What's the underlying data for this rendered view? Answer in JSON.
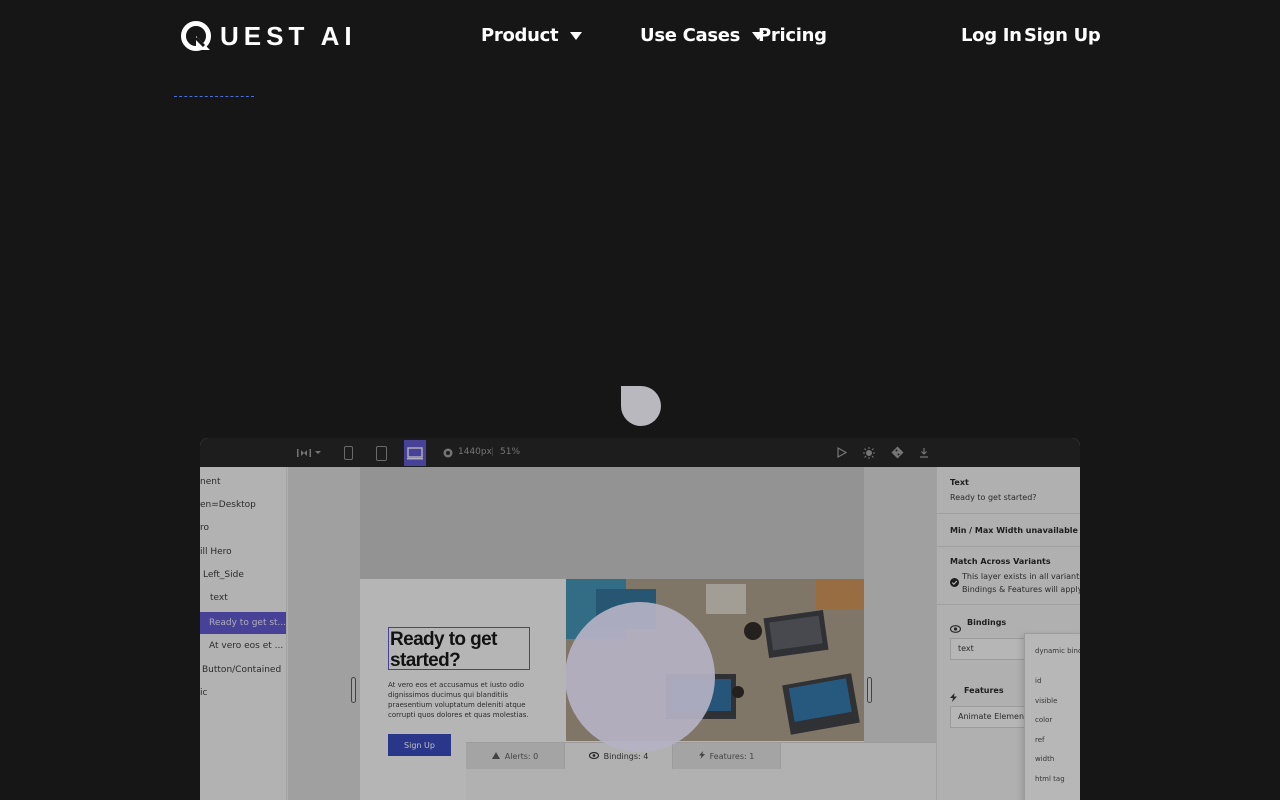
{
  "nav": {
    "logo_text": "UEST AI",
    "product": "Product",
    "use_cases": "Use Cases",
    "pricing": "Pricing",
    "login": "Log In",
    "signup": "Sign Up"
  },
  "editor": {
    "toolbar": {
      "width_label": "1440px",
      "zoom_label": "51%"
    },
    "layers": [
      "nent",
      "en=Desktop",
      "ro",
      "ill Hero",
      "Left_Side",
      "text",
      "Ready to get st...",
      "At vero eos et ...",
      "Button/Contained",
      "ic"
    ],
    "artboard": {
      "heading": "Ready to get started?",
      "paragraph": "At vero eos et accusamus et iusto odio dignissimos ducimus qui blanditiis praesentium voluptatum deleniti atque corrupti quos dolores et quas molestias.",
      "button": "Sign Up"
    },
    "bottom_tabs": [
      {
        "label": "Alerts: 0"
      },
      {
        "label": "Bindings: 4"
      },
      {
        "label": "Features: 1"
      }
    ],
    "props": {
      "text_label": "Text",
      "text_value": "Ready to get started?",
      "minmax_note": "Min / Max Width unavailable on Fixed",
      "match_label": "Match Across Variants",
      "match_note_1": "This layer exists in all variants.",
      "match_note_2": "Bindings & Features will apply to",
      "bindings_label": "Bindings",
      "bindings_value": "text",
      "features_label": "Features",
      "features_value": "Animate Element"
    },
    "dropdown": {
      "header": "dynamic bind",
      "items": [
        "id",
        "visible",
        "color",
        "ref",
        "width",
        "html tag"
      ]
    }
  }
}
